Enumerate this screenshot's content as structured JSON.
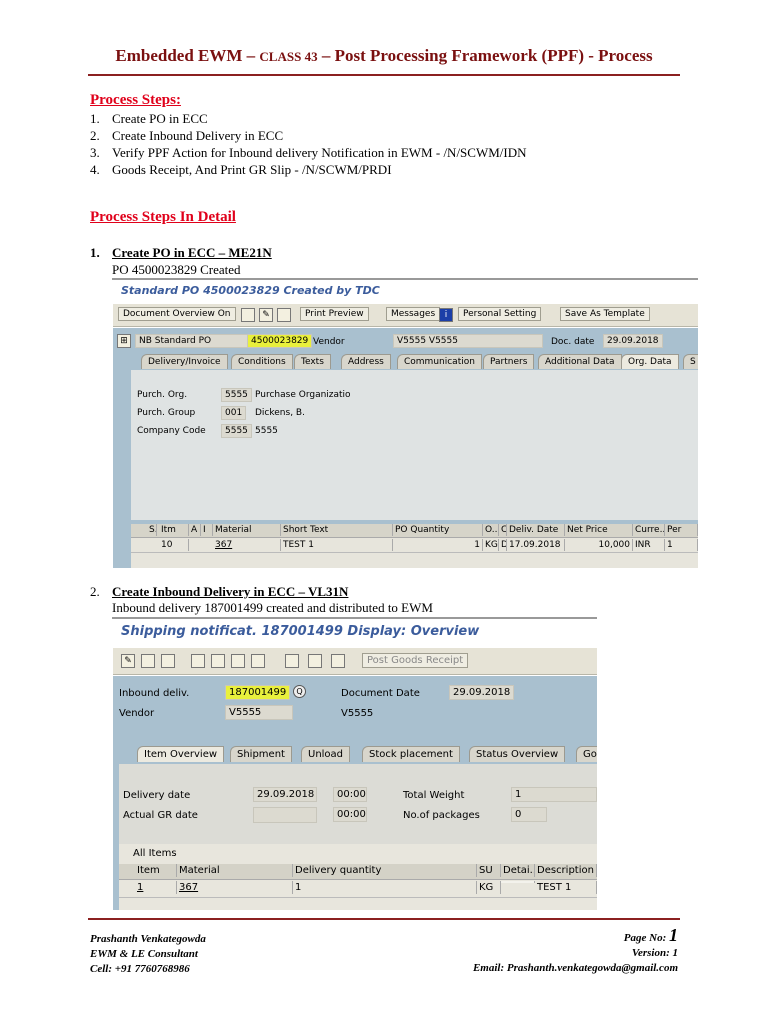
{
  "header": {
    "title_a": "Embedded EWM",
    "sep1": " – ",
    "title_b": "CLASS 43",
    "sep2": " – ",
    "title_c": "Post Processing Framework (PPF) - Process"
  },
  "process_steps": {
    "heading": "Process Steps:",
    "items": [
      {
        "n": "1.",
        "text": "Create PO in ECC"
      },
      {
        "n": "2.",
        "text": "Create Inbound Delivery in ECC"
      },
      {
        "n": "3.",
        "text": "Verify PPF Action for Inbound delivery Notification in EWM - /N/SCWM/IDN"
      },
      {
        "n": "4.",
        "text": "Goods Receipt, And Print GR Slip - /N/SCWM/PRDI"
      }
    ]
  },
  "detail_heading": "Process Steps In Detail",
  "step1": {
    "n": "1.",
    "title": "Create PO in ECC – ME21N",
    "desc": "PO 4500023829 Created",
    "screen": {
      "title": "Standard PO 4500023829 Created by TDC",
      "toolbar": {
        "doc_overview": "Document Overview On",
        "print_preview": "Print Preview",
        "messages": "Messages",
        "personal_setting": "Personal Setting",
        "save_template": "Save As Template"
      },
      "doc_type": "NB Standard PO",
      "po_number": "4500023829",
      "vendor_label": "Vendor",
      "vendor_value": "V5555 V5555",
      "doc_date_label": "Doc. date",
      "doc_date": "29.09.2018",
      "tabs": [
        "Delivery/Invoice",
        "Conditions",
        "Texts",
        "Address",
        "Communication",
        "Partners",
        "Additional Data",
        "Org. Data",
        "S"
      ],
      "org": [
        {
          "label": "Purch. Org.",
          "code": "5555",
          "text": "Purchase Organizatio"
        },
        {
          "label": "Purch. Group",
          "code": "001",
          "text": "Dickens, B."
        },
        {
          "label": "Company Code",
          "code": "5555",
          "text": "5555"
        }
      ],
      "columns": [
        "S..",
        "Itm",
        "A",
        "I",
        "Material",
        "Short Text",
        "PO Quantity",
        "O..",
        "C",
        "Deliv. Date",
        "Net Price",
        "Curre..",
        "Per"
      ],
      "row": [
        "",
        "10",
        "",
        "",
        "367",
        "TEST 1",
        "1",
        "KG",
        "D",
        "17.09.2018",
        "10,000",
        "INR",
        "1"
      ]
    }
  },
  "step2": {
    "n": "2.",
    "title": "Create Inbound Delivery in ECC – VL31N",
    "desc": "Inbound delivery 187001499 created and distributed to EWM",
    "screen": {
      "title": "Shipping notificat. 187001499 Display: Overview",
      "post_gr": "Post Goods Receipt",
      "inb_label": "Inbound deliv.",
      "inb_value": "187001499",
      "doc_date_label": "Document Date",
      "doc_date": "29.09.2018",
      "vendor_label": "Vendor",
      "vendor_value": "V5555",
      "vendor_name": "V5555",
      "tabs": [
        "Item Overview",
        "Shipment",
        "Unload",
        "Stock placement",
        "Status Overview",
        "Go"
      ],
      "delivery_date_label": "Delivery date",
      "delivery_date": "29.09.2018",
      "delivery_time": "00:00",
      "actual_gr_label": "Actual GR date",
      "actual_gr_time": "00:00",
      "total_weight_label": "Total Weight",
      "total_weight": "1",
      "packages_label": "No.of packages",
      "packages": "0",
      "all_items": "All Items",
      "columns": [
        "Item",
        "Material",
        "Delivery quantity",
        "SU",
        "Detai..",
        "Description"
      ],
      "row": [
        "1",
        "367",
        "1",
        "KG",
        "",
        "TEST 1"
      ]
    }
  },
  "footer": {
    "name": "Prashanth Venkategowda",
    "role": "EWM & LE Consultant",
    "cell": "Cell: +91 7760768986",
    "page_label": "Page No:",
    "page": "1",
    "version": "Version: 1",
    "email": "Email: Prashanth.venkategowda@gmail.com"
  }
}
